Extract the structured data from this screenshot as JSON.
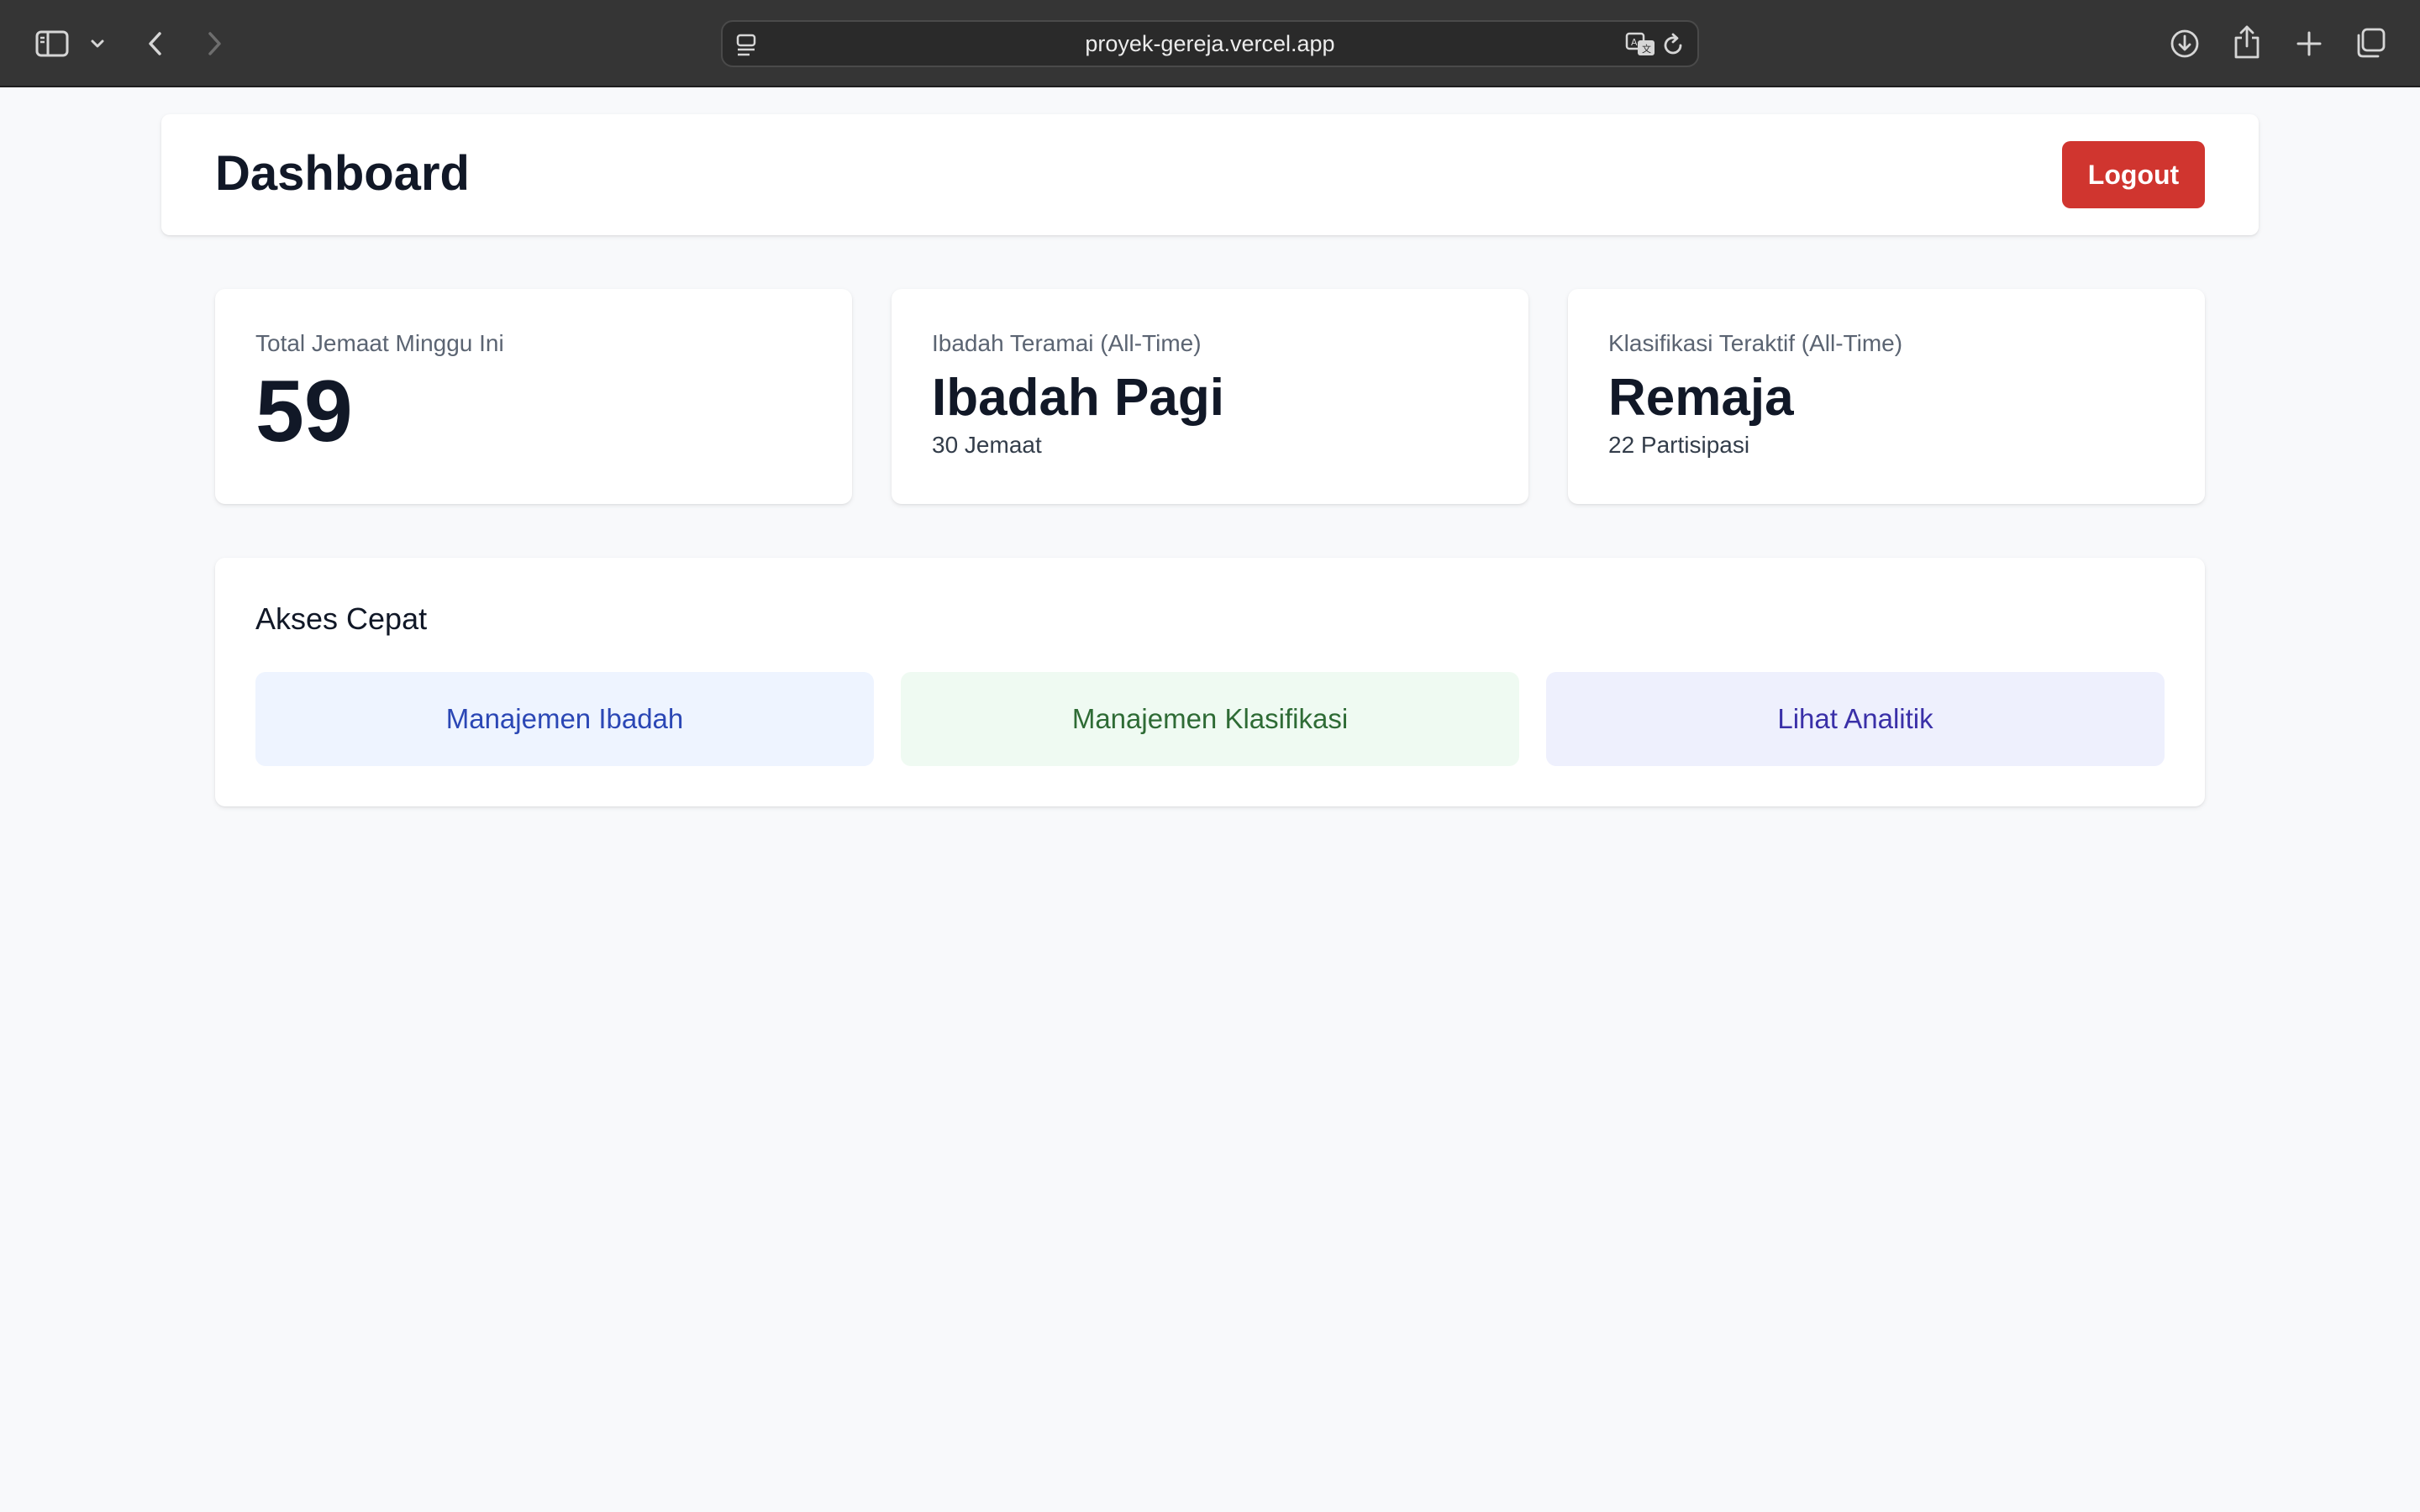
{
  "browser": {
    "url": "proyek-gereja.vercel.app",
    "icons": [
      "sidebar-icon",
      "chevron-down-icon",
      "back-icon",
      "forward-icon",
      "page-menu-icon",
      "translate-icon",
      "reload-icon",
      "download-icon",
      "share-icon",
      "new-tab-icon",
      "tabs-overview-icon"
    ]
  },
  "header": {
    "title": "Dashboard",
    "logout_label": "Logout",
    "logout_color": "#d0352f"
  },
  "stats": [
    {
      "label": "Total Jemaat Minggu Ini",
      "value": "59"
    },
    {
      "label": "Ibadah Teramai (All-Time)",
      "value": "Ibadah Pagi",
      "sub": "30 Jemaat"
    },
    {
      "label": "Klasifikasi Teraktif (All-Time)",
      "value": "Remaja",
      "sub": "22 Partisipasi"
    }
  ],
  "quick_access": {
    "title": "Akses Cepat",
    "buttons": [
      {
        "label": "Manajemen Ibadah",
        "bg": "#eef4ff",
        "color": "#2b47b5"
      },
      {
        "label": "Manajemen Klasifikasi",
        "bg": "#effaf2",
        "color": "#2e6b35"
      },
      {
        "label": "Lihat Analitik",
        "bg": "#eef0fd",
        "color": "#3a30a8"
      }
    ]
  }
}
